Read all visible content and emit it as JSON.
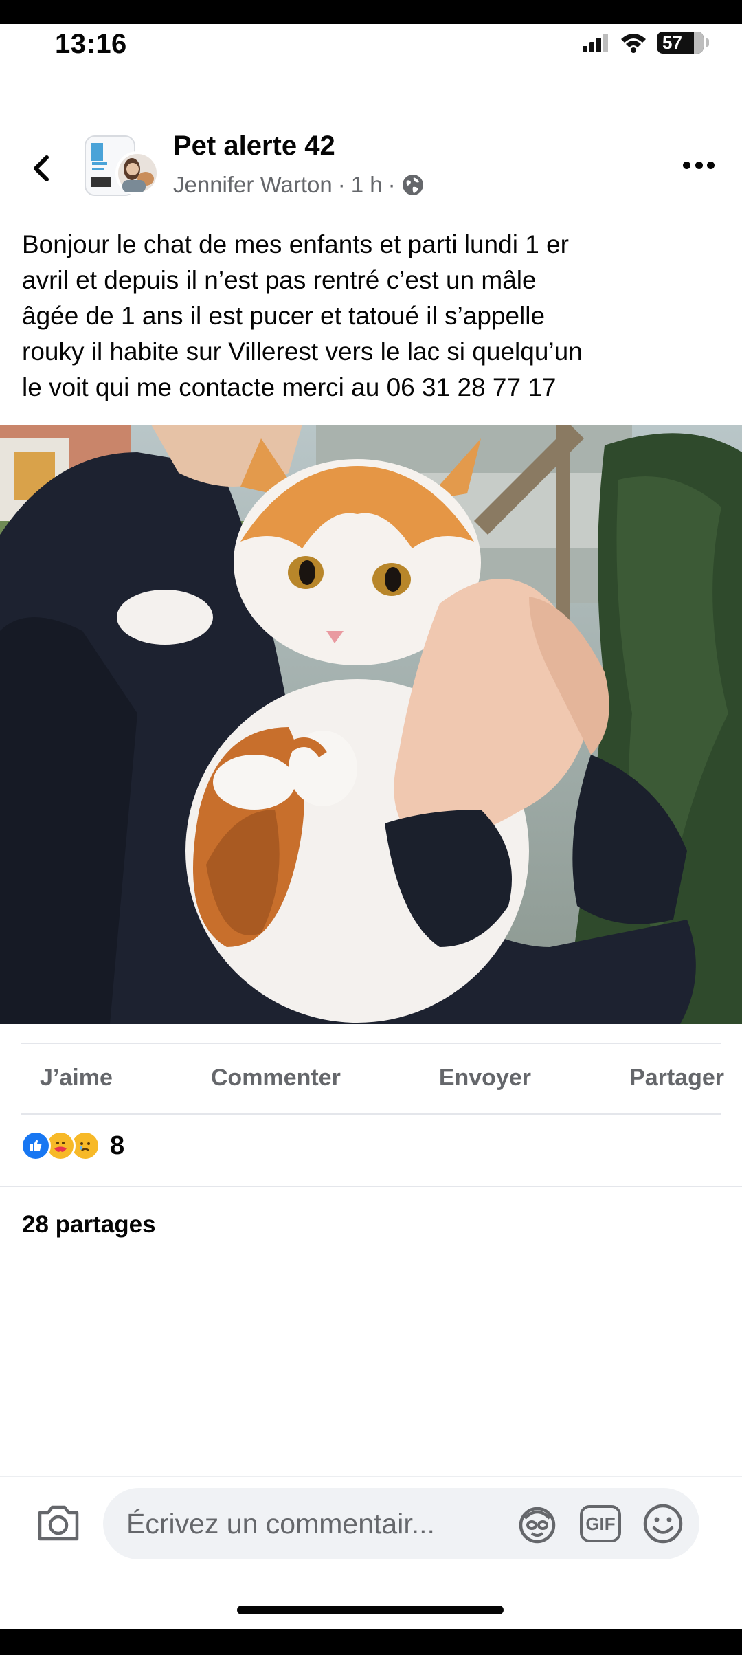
{
  "status_bar": {
    "time": "13:16",
    "battery": "57"
  },
  "post": {
    "group_name": "Pet alerte 42",
    "author": "Jennifer Warton",
    "time_ago": "1 h",
    "separator": "·",
    "text": "Bonjour le chat de mes enfants et parti lundi 1 er\navril et depuis il n’est pas rentré c’est un mâle\nâgée de 1 ans il est pucer et tatoué il s’appelle\nrouky il habite sur Villerest vers le lac si quelqu’un\nle voit qui me contacte merci au  06 31 28 77 17"
  },
  "actions": {
    "like": "J’aime",
    "comment": "Commenter",
    "send": "Envoyer",
    "share": "Partager"
  },
  "engagement": {
    "reaction_count": "8",
    "reactions": [
      "like-icon",
      "care-icon",
      "sad-icon"
    ],
    "shares": "28 partages"
  },
  "composer": {
    "placeholder": "Écrivez un commentair...",
    "gif_label": "GIF"
  },
  "colors": {
    "accent_blue": "#1877f2",
    "secondary_text": "#65676b",
    "input_bg": "#f0f2f5"
  }
}
